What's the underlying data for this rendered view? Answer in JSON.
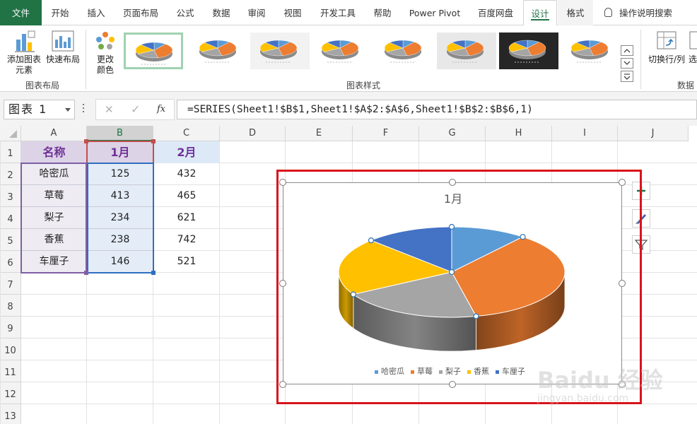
{
  "ribbon_tabs": [
    "文件",
    "开始",
    "插入",
    "页面布局",
    "公式",
    "数据",
    "审阅",
    "视图",
    "开发工具",
    "帮助",
    "Power Pivot",
    "百度网盘",
    "设计",
    "格式",
    "操作说明搜索"
  ],
  "ribbon": {
    "add_element": "添加图表元素",
    "add_element_line1": "添加图表",
    "add_element_line2": "元素",
    "quick_layout": "快速布局",
    "change_color": "更改颜色",
    "change_color_line1": "更改",
    "change_color_line2": "颜色",
    "group_chart_layout": "图表布局",
    "group_chart_styles": "图表样式",
    "switch_row_col": "切换行/列",
    "select_data_partial": "选",
    "group_data": "数据",
    "style_count": 8
  },
  "formula_bar": {
    "name_box": "图表 1",
    "cancel_icon": "✕",
    "enter_icon": "✓",
    "fx_label": "fx",
    "formula": "=SERIES(Sheet1!$B$1,Sheet1!$A$2:$A$6,Sheet1!$B$2:$B$6,1)"
  },
  "grid": {
    "columns": [
      "A",
      "B",
      "C",
      "D",
      "E",
      "F",
      "G",
      "H",
      "I",
      "J"
    ],
    "rows": [
      "1",
      "2",
      "3",
      "4",
      "5",
      "6",
      "7",
      "8",
      "9",
      "10",
      "11",
      "12",
      "13"
    ],
    "table_header": [
      "名称",
      "1月",
      "2月"
    ],
    "table_rows": [
      [
        "哈密瓜",
        "125",
        "432"
      ],
      [
        "草莓",
        "413",
        "465"
      ],
      [
        "梨子",
        "234",
        "621"
      ],
      [
        "香蕉",
        "238",
        "742"
      ],
      [
        "车厘子",
        "146",
        "521"
      ]
    ],
    "header_fill": "#dcd3e6",
    "col_a_fill": "#eeebf3",
    "col_b_fill": "#e4ecf7",
    "col_c_header_fill": "#dde9f6"
  },
  "chart_data": {
    "type": "pie",
    "title": "1月",
    "categories": [
      "哈密瓜",
      "草莓",
      "梨子",
      "香蕉",
      "车厘子"
    ],
    "values": [
      125,
      413,
      234,
      238,
      146
    ],
    "colors": [
      "#5b9bd5",
      "#ed7d31",
      "#a5a5a5",
      "#ffc000",
      "#4472c4"
    ],
    "style": "3d",
    "legend": "bottom"
  },
  "side_buttons": [
    "chart-elements-plus-icon",
    "chart-styles-brush-icon",
    "chart-filter-icon"
  ],
  "watermark": {
    "line1": "Baidu 经验",
    "line2": "jingyan.baidu.com"
  },
  "colors": {
    "excel_green": "#217346",
    "selection_red": "#d9131b",
    "purple_text": "#6f3198"
  }
}
